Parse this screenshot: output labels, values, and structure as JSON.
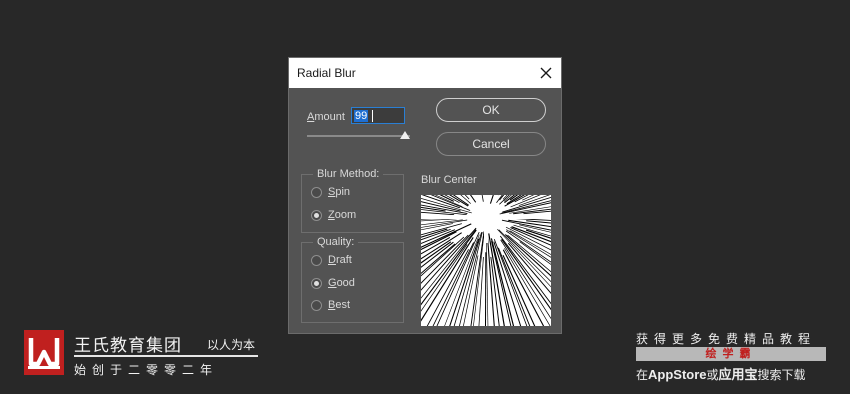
{
  "dialog": {
    "title": "Radial Blur",
    "amount_label_first": "A",
    "amount_label_rest": "mount",
    "amount_value": "99",
    "amount_slider_fraction": 0.99,
    "ok_label": "OK",
    "cancel_label": "Cancel",
    "blur_method": {
      "title": "Blur Method:",
      "options": [
        {
          "first": "S",
          "rest": "pin",
          "selected": false
        },
        {
          "first": "Z",
          "rest": "oom",
          "selected": true
        }
      ]
    },
    "quality": {
      "title": "Quality:",
      "options": [
        {
          "first": "D",
          "rest": "raft",
          "selected": false
        },
        {
          "first": "G",
          "rest": "ood",
          "selected": true
        },
        {
          "first": "B",
          "rest": "est",
          "selected": false
        }
      ]
    },
    "blur_center_label": "Blur Center"
  },
  "watermark": {
    "brand": "王氏教育集团",
    "slogan": "以人为本",
    "founded": "始创于二零零二年",
    "promo_top": "获得更多免费精品教程",
    "promo_app": "绘学霸",
    "promo_bottom_pre": "在",
    "promo_bottom_store": "AppStore",
    "promo_bottom_or": "或",
    "promo_bottom_app": "应用宝",
    "promo_bottom_post": "搜索下载"
  },
  "colors": {
    "background": "#282828",
    "dialog_bg": "#535353",
    "accent_blue": "#1f6fd1",
    "brand_red": "#c0201f"
  }
}
